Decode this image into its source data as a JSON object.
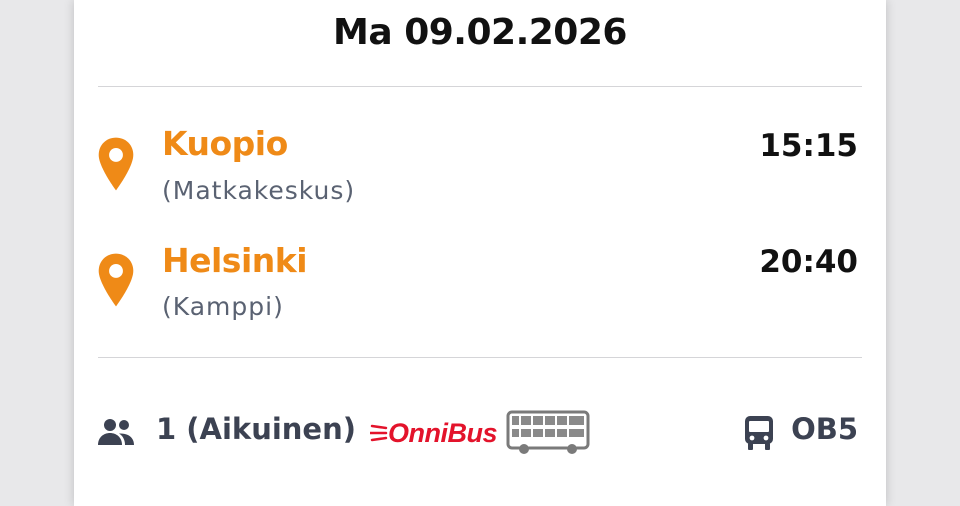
{
  "trip": {
    "date": "Ma 09.02.2026",
    "departure": {
      "city": "Kuopio",
      "station": "(Matkakeskus)",
      "time": "15:15"
    },
    "arrival": {
      "city": "Helsinki",
      "station": "(Kamppi)",
      "time": "20:40"
    }
  },
  "passengers": {
    "label": "1 (Aikuinen)"
  },
  "operator": {
    "name": "OnniBus",
    "color": "#e3132b"
  },
  "route": {
    "code": "OB5"
  },
  "colors": {
    "accent": "#ef8a17",
    "muted": "#5a6272",
    "icon": "#3c4252"
  }
}
